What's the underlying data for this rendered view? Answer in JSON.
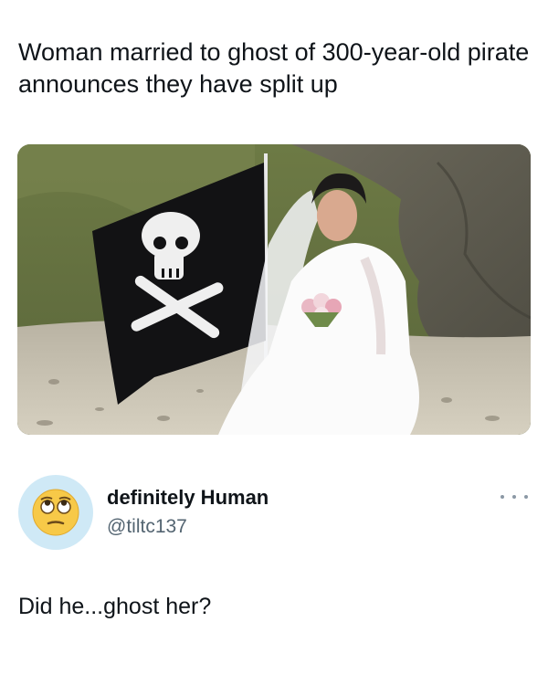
{
  "post": {
    "headline": "Woman married to ghost of 300-year-old pirate announces they have split up",
    "image_alt": "Bride in white wedding dress holding a bouquet beside a Jolly Roger pirate flag on a rocky beach"
  },
  "reply": {
    "display_name": "definitely Human",
    "handle": "@tiltc137",
    "text": "Did he...ghost her?",
    "avatar_icon": "eye-roll-emoji-icon"
  },
  "colors": {
    "text_primary": "#0f1419",
    "text_secondary": "#536471",
    "avatar_bg": "#cfe9f6"
  }
}
